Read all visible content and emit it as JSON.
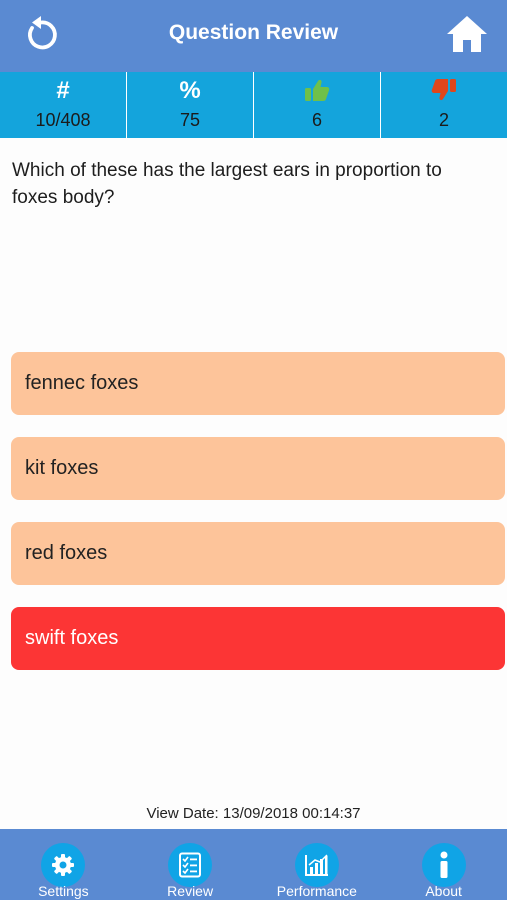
{
  "header": {
    "title": "Question Review",
    "back_icon": "refresh-back-icon",
    "home_icon": "home-icon"
  },
  "stats": [
    {
      "symbol": "#",
      "value": "10/408",
      "icon": "hash-icon"
    },
    {
      "symbol": "%",
      "value": "75",
      "icon": "percent-icon"
    },
    {
      "symbol": "",
      "value": "6",
      "icon": "thumbs-up-icon"
    },
    {
      "symbol": "",
      "value": "2",
      "icon": "thumbs-down-icon"
    }
  ],
  "question": {
    "text": "Which of these has the largest ears in proportion to foxes body?"
  },
  "answers": [
    {
      "label": "fennec foxes",
      "state": "neutral"
    },
    {
      "label": "kit foxes",
      "state": "neutral"
    },
    {
      "label": "red foxes",
      "state": "neutral"
    },
    {
      "label": "swift foxes",
      "state": "wrong"
    }
  ],
  "view_date": "View Date: 13/09/2018 00:14:37",
  "tabbar": {
    "tabs": [
      {
        "label": "Settings",
        "icon": "gear-icon"
      },
      {
        "label": "Review",
        "icon": "checklist-icon"
      },
      {
        "label": "Performance",
        "icon": "bar-chart-icon"
      },
      {
        "label": "About",
        "icon": "info-icon"
      }
    ]
  },
  "colors": {
    "header_bg": "#5a8ad2",
    "stats_bg": "#14a4dc",
    "answer_bg": "#fdc49a",
    "wrong_bg": "#fc3535",
    "tab_icon_bg": "#10a4e6",
    "thumbs_up": "#6fc04a",
    "thumbs_down": "#e0461c"
  }
}
